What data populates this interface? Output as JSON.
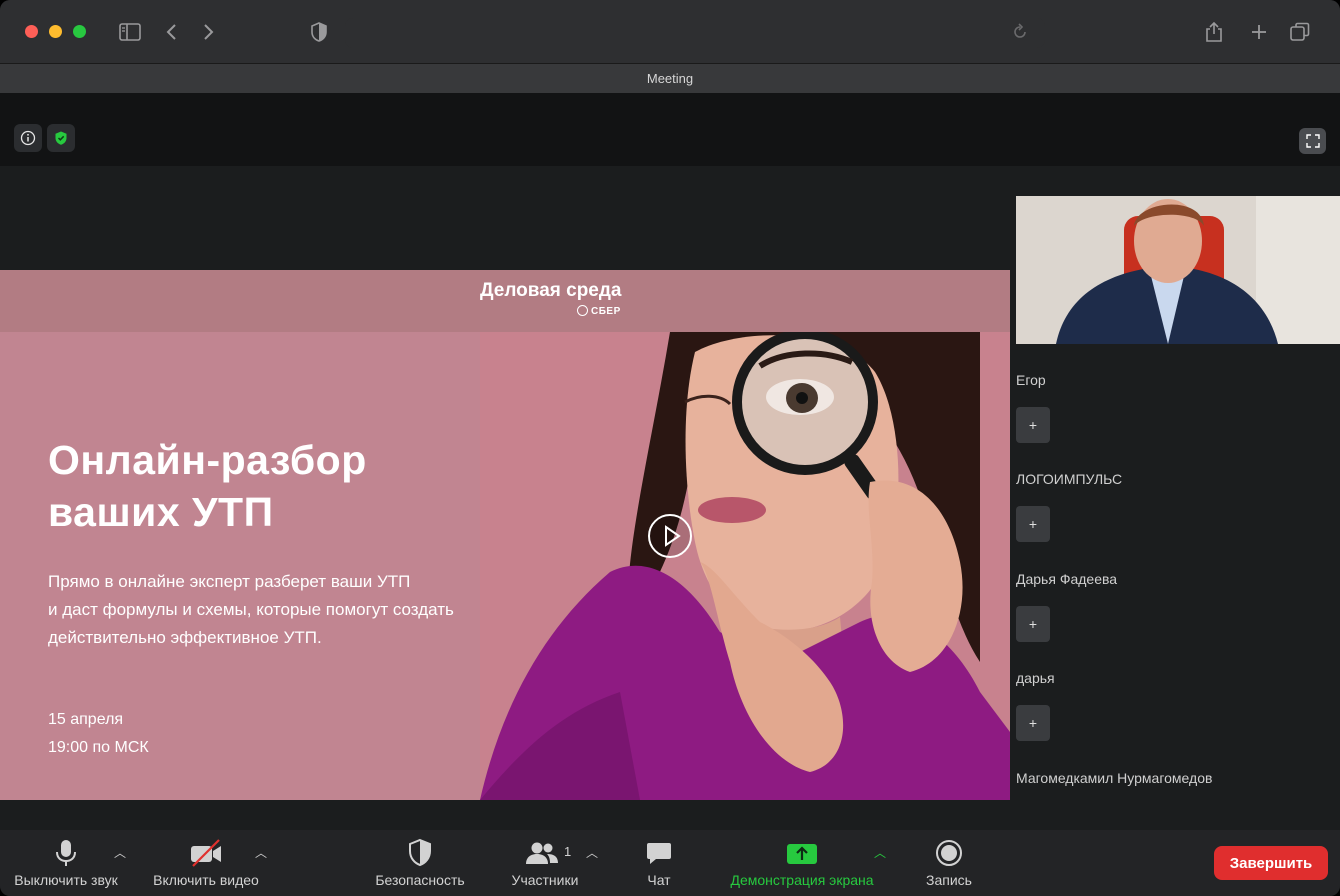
{
  "window": {
    "title": "Meeting"
  },
  "slide": {
    "brand": "Деловая среда",
    "brand_sub": "СБЕР",
    "headline_line1": "Онлайн-разбор",
    "headline_line2": "ваших УТП",
    "desc_line1": "Прямо в онлайне эксперт разберет ваши УТП",
    "desc_line2": "и даст формулы и схемы, которые помогут создать",
    "desc_line3": "действительно эффективное УТП.",
    "date_line1": "15 апреля",
    "date_line2": "19:00 по МСК"
  },
  "participants": [
    {
      "name": "Егор",
      "add": "+"
    },
    {
      "name": "ЛОГОИМПУЛЬС",
      "add": "+"
    },
    {
      "name": "Дарья Фадеева",
      "add": "+"
    },
    {
      "name": "дарья",
      "add": "+"
    },
    {
      "name": "Магомедкамил Нурмагомедов"
    }
  ],
  "toolbar": {
    "mute_label": "Выключить звук",
    "video_label": "Включить видео",
    "security_label": "Безопасность",
    "participants_label": "Участники",
    "participants_count": "1",
    "chat_label": "Чат",
    "share_label": "Демонстрация экрана",
    "record_label": "Запись",
    "end_label": "Завершить"
  },
  "colors": {
    "share_green": "#27c93f",
    "end_red": "#e02e2e",
    "slide_pink": "#c18591",
    "sweater_purple": "#8e1b82"
  }
}
